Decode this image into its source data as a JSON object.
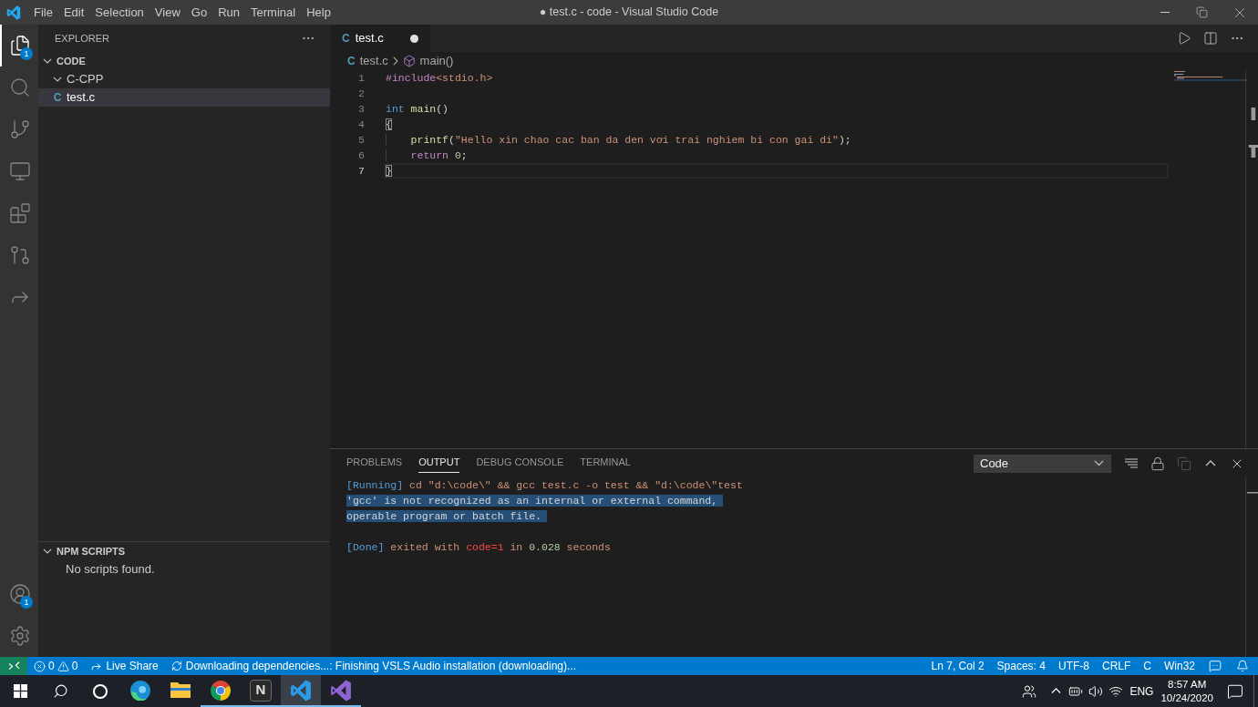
{
  "title_bar": {
    "menu": [
      "File",
      "Edit",
      "Selection",
      "View",
      "Go",
      "Run",
      "Terminal",
      "Help"
    ],
    "title": "● test.c - code - Visual Studio Code"
  },
  "activity_bar": {
    "top_items": [
      {
        "selected": true,
        "badge": "1"
      },
      {
        "selected": false
      },
      {
        "selected": false
      },
      {
        "selected": false
      },
      {
        "selected": false
      },
      {
        "selected": false
      },
      {
        "selected": false
      }
    ],
    "bottom_items": [
      {
        "selected": false,
        "badge": "1"
      },
      {
        "selected": false
      }
    ]
  },
  "sidebar": {
    "title": "EXPLORER",
    "sections": [
      {
        "title": "CODE",
        "expanded": true,
        "tree": [
          {
            "kind": "folder",
            "label": "C-CPP",
            "expanded": true,
            "selected": false,
            "children": [
              {
                "kind": "file",
                "icon": "C",
                "label": "test.c",
                "selected": true
              }
            ]
          }
        ]
      },
      {
        "title": "NPM SCRIPTS",
        "expanded": true,
        "message": "No scripts found."
      }
    ]
  },
  "editor": {
    "tabs": [
      {
        "icon": "C",
        "label": "test.c",
        "selected": true,
        "dirty": true
      }
    ],
    "breadcrumb": [
      {
        "kind": "file",
        "icon": "C",
        "label": "test.c"
      },
      {
        "kind": "symbol",
        "label": "main()"
      }
    ],
    "lines": [
      {
        "number": "1",
        "current": false,
        "indented": false,
        "tokens": [
          {
            "kind": "directive",
            "text": "#include"
          },
          {
            "kind": "string",
            "text": "<stdio.h>"
          }
        ]
      },
      {
        "number": "2",
        "current": false,
        "indented": false
      },
      {
        "number": "3",
        "current": false,
        "indented": false,
        "tokens": [
          {
            "kind": "keyword",
            "text": "int "
          },
          {
            "kind": "function",
            "text": "main"
          },
          {
            "kind": "plain",
            "text": "()"
          }
        ]
      },
      {
        "number": "4",
        "current": false,
        "indented": false,
        "tokens": [
          {
            "kind": "bracket",
            "text": "{"
          }
        ]
      },
      {
        "number": "5",
        "current": false,
        "indented": true,
        "tokens": [
          {
            "kind": "function",
            "text": "printf"
          },
          {
            "kind": "plain",
            "text": "("
          },
          {
            "kind": "string",
            "text": "\"Hello xin chao cac ban da den vơi trai nghiem bi con gai di\""
          },
          {
            "kind": "plain",
            "text": ");"
          }
        ]
      },
      {
        "number": "6",
        "current": false,
        "indented": true,
        "tokens": [
          {
            "kind": "control",
            "text": "return "
          },
          {
            "kind": "number",
            "text": "0"
          },
          {
            "kind": "plain",
            "text": ";"
          }
        ]
      },
      {
        "number": "7",
        "current": true,
        "indented": false,
        "tokens": [
          {
            "kind": "bracket",
            "text": "}"
          }
        ]
      }
    ]
  },
  "panel": {
    "tabs": [
      {
        "label": "PROBLEMS",
        "selected": false
      },
      {
        "label": "OUTPUT",
        "selected": true
      },
      {
        "label": "DEBUG CONSOLE",
        "selected": false
      },
      {
        "label": "TERMINAL",
        "selected": false
      }
    ],
    "channel": {
      "value": "Code"
    },
    "actions": [
      {
        "disabled": false
      },
      {
        "disabled": false
      },
      {
        "disabled": true
      },
      {
        "disabled": false
      },
      {
        "disabled": false
      }
    ],
    "output": {
      "blocks": [
        {
          "lines": [
            {
              "selected": false,
              "tokens": [
                {
                  "kind": "tag",
                  "text": "[Running]"
                },
                {
                  "kind": "text",
                  "text": " cd \"d:\\code\\\" && gcc test.c -o test && \"d:\\code\\\"test"
                }
              ]
            },
            {
              "selected": true,
              "tokens": [
                {
                  "kind": "plain",
                  "text": "'gcc' is not recognized as an internal or external command,"
                }
              ]
            },
            {
              "selected": true,
              "tokens": [
                {
                  "kind": "plain",
                  "text": "operable program or batch file."
                }
              ]
            }
          ]
        },
        {
          "lines": [
            {
              "selected": false,
              "tokens": [
                {
                  "kind": "tag",
                  "text": "[Done]"
                },
                {
                  "kind": "text",
                  "text": " exited with "
                },
                {
                  "kind": "error",
                  "text": "code=1"
                },
                {
                  "kind": "text",
                  "text": " in "
                },
                {
                  "kind": "number",
                  "text": "0.028"
                },
                {
                  "kind": "text",
                  "text": " seconds"
                }
              ]
            }
          ]
        }
      ]
    }
  },
  "status_bar": {
    "left": [
      {
        "kind": "remote"
      },
      {
        "kind": "problems",
        "errors": "0",
        "warnings": "0"
      },
      {
        "kind": "live-share",
        "label": "Live Share"
      },
      {
        "kind": "progress",
        "label": "Downloading dependencies...: Finishing VSLS Audio installation (downloading)..."
      }
    ],
    "right": [
      {
        "kind": "text",
        "label": "Ln 7, Col 2"
      },
      {
        "kind": "text",
        "label": "Spaces: 4"
      },
      {
        "kind": "text",
        "label": "UTF-8"
      },
      {
        "kind": "text",
        "label": "CRLF"
      },
      {
        "kind": "text",
        "label": "C"
      },
      {
        "kind": "text",
        "label": "Win32"
      },
      {
        "kind": "feedback"
      },
      {
        "kind": "notifications"
      }
    ]
  },
  "taskbar": {
    "apps": [
      {
        "running": false,
        "active": false
      },
      {
        "running": false,
        "active": false
      },
      {
        "running": true,
        "active": false
      },
      {
        "running": true,
        "active": false,
        "glyph": "N"
      },
      {
        "running": true,
        "active": true
      },
      {
        "running": true,
        "active": false
      }
    ],
    "tray": {
      "language": "ENG",
      "time": "8:57 AM",
      "date": "10/24/2020"
    }
  }
}
